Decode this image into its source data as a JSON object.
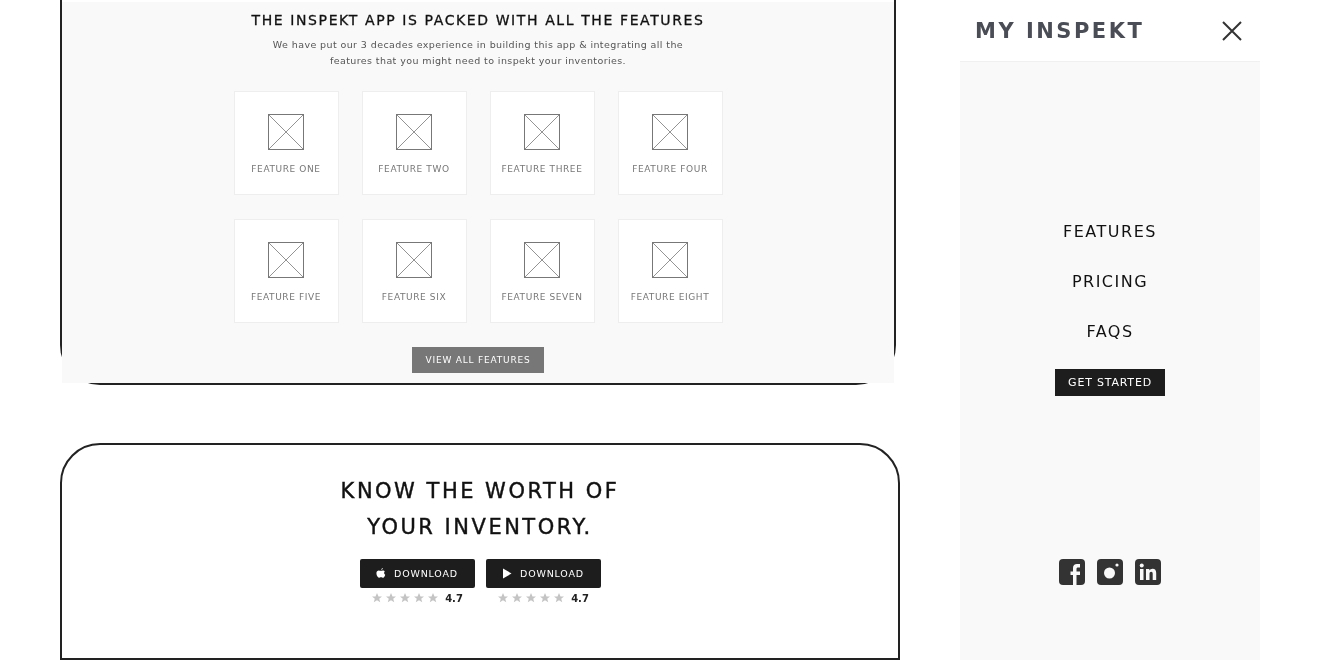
{
  "features_section": {
    "title": "THE INSPEKT APP IS PACKED WITH ALL THE FEATURES",
    "description": "We have put our 3 decades experience in building this app & integrating all the features that you might need to inspekt your inventories.",
    "features": [
      "FEATURE ONE",
      "FEATURE TWO",
      "FEATURE THREE",
      "FEATURE FOUR",
      "FEATURE FIVE",
      "FEATURE SIX",
      "FEATURE SEVEN",
      "FEATURE EIGHT"
    ],
    "button": "VIEW ALL FEATURES"
  },
  "download_section": {
    "title_lines": [
      "KNOW THE WORTH OF",
      "YOUR INVENTORY."
    ],
    "stores": [
      {
        "kind": "apple",
        "label": "DOWNLOAD",
        "stars": 0,
        "rating": "4.7"
      },
      {
        "kind": "play",
        "label": "DOWNLOAD",
        "stars": 0,
        "rating": "4.7"
      }
    ]
  },
  "menu": {
    "title": "MY INSPEKT",
    "items": [
      "FEATURES",
      "PRICING",
      "FAQS"
    ],
    "cta": "GET STARTED",
    "social": [
      {
        "kind": "facebook"
      },
      {
        "kind": "instagram"
      },
      {
        "kind": "linkedin"
      }
    ]
  }
}
